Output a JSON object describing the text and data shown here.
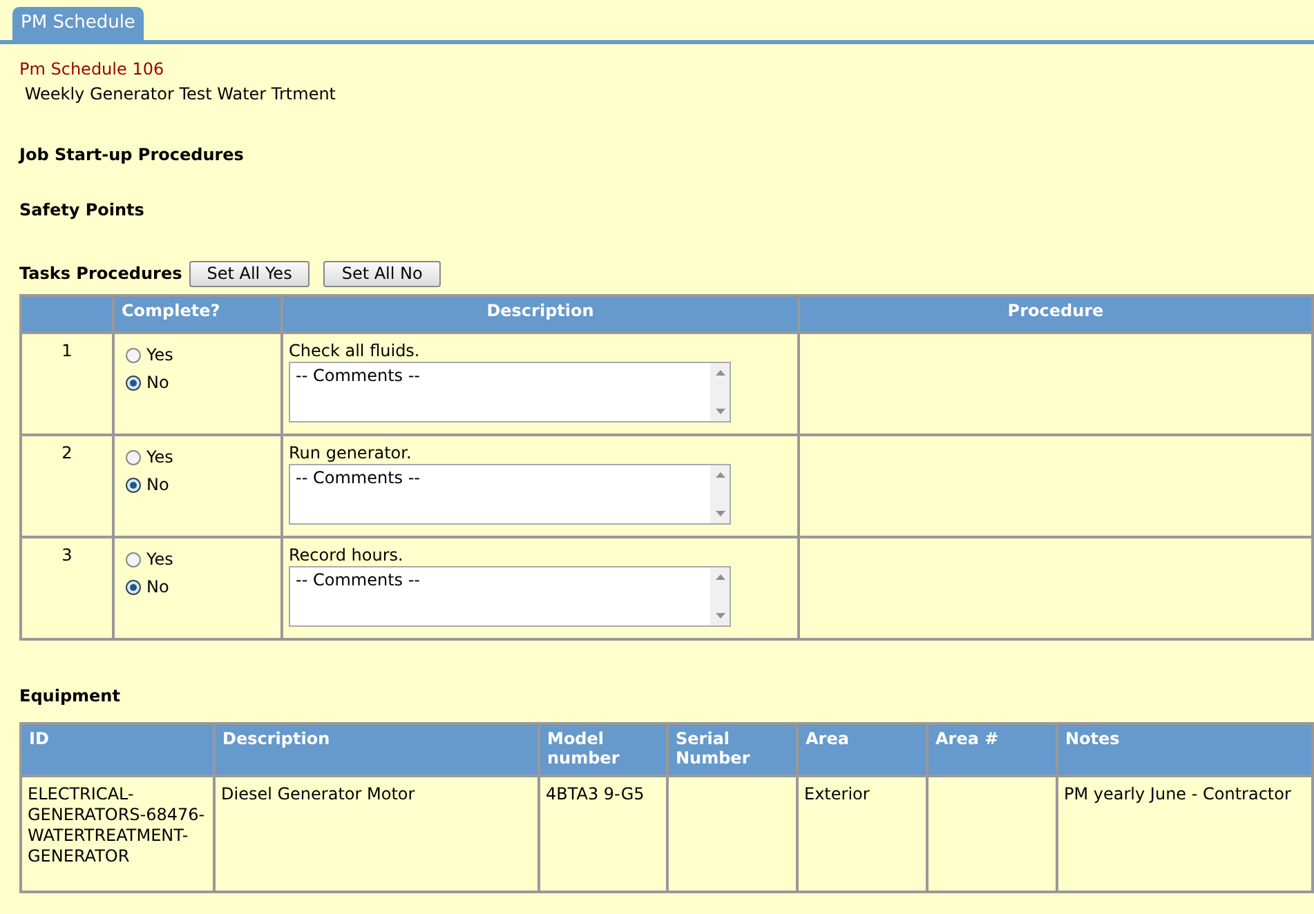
{
  "tabs": [
    {
      "label": "PM Schedule",
      "selected": true
    }
  ],
  "schedule": {
    "number": "Pm Schedule 106",
    "name": " Weekly Generator Test Water Trtment"
  },
  "section_headings": [
    "Job Start-up Procedures",
    "Safety Points"
  ],
  "tasks": {
    "heading": "Tasks Procedures",
    "buttons": [
      "Set All Yes",
      "Set All No"
    ],
    "columns": [
      "",
      "Complete?",
      "Description",
      "Procedure"
    ],
    "rows": [
      {
        "number": "1",
        "options": [
          {
            "label": "Yes",
            "selected": false
          },
          {
            "label": "No",
            "selected": true
          }
        ],
        "description": "Check all fluids.",
        "comment": "-- Comments --"
      },
      {
        "number": "2",
        "options": [
          {
            "label": "Yes",
            "selected": false
          },
          {
            "label": "No",
            "selected": true
          }
        ],
        "description": "Run generator.",
        "comment": "-- Comments --"
      },
      {
        "number": "3",
        "options": [
          {
            "label": "Yes",
            "selected": false
          },
          {
            "label": "No",
            "selected": true
          }
        ],
        "description": "Record hours.",
        "comment": "-- Comments --"
      }
    ]
  },
  "equipment": {
    "heading": "Equipment",
    "columns": [
      "ID",
      "Description",
      "Model number",
      "Serial Number",
      "Area",
      "Area #",
      "Notes"
    ],
    "rows": [
      [
        "ELECTRICAL-GENERATORS-68476-WATERTREATMENT-GENERATOR",
        "Diesel Generator Motor",
        "4BTA3 9-G5",
        "",
        "Exterior",
        "",
        "PM yearly June - Contractor"
      ]
    ]
  }
}
